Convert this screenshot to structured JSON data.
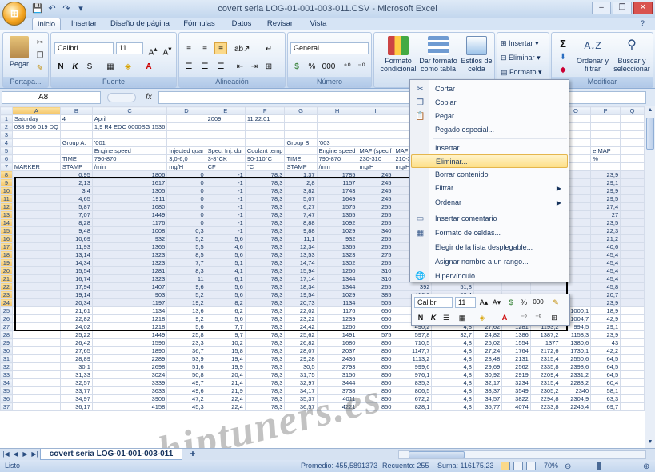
{
  "app": {
    "title": "covert seria LOG-01-001-003-011.CSV - Microsoft Excel"
  },
  "tabs": [
    "Inicio",
    "Insertar",
    "Diseño de página",
    "Fórmulas",
    "Datos",
    "Revisar",
    "Vista"
  ],
  "ribbon": {
    "portapapeles": {
      "label": "Portapa...",
      "paste": "Pegar"
    },
    "fuente": {
      "label": "Fuente",
      "font": "Calibri",
      "size": "11",
      "bold": "N",
      "italic": "K",
      "underline": "S"
    },
    "alineacion": {
      "label": "Alineación"
    },
    "numero": {
      "label": "Número",
      "format": "General",
      "percent": "%",
      "thousands": "000"
    },
    "estilos": {
      "cond": "Formato condicional",
      "table": "Dar formato como tabla",
      "cell": "Estilos de celda"
    },
    "celdas": {
      "insert": "Insertar",
      "delete": "Eliminar",
      "format": "Formato"
    },
    "modificar": {
      "label": "Modificar",
      "sort": "Ordenar y filtrar",
      "find": "Buscar y seleccionar",
      "sum": "Σ"
    }
  },
  "formula_bar": {
    "namebox": "A8",
    "fx": "fx",
    "value": ""
  },
  "grid": {
    "columns": [
      "A",
      "B",
      "C",
      "D",
      "E",
      "F",
      "G",
      "H",
      "I",
      "J",
      "K",
      "L",
      "M",
      "N",
      "O",
      "P",
      "Q"
    ],
    "rows": [
      {
        "n": "1",
        "c": [
          "Saturday",
          "4",
          "April",
          "",
          "2009",
          "11:22:01",
          "",
          "",
          "",
          "",
          "",
          "",
          "",
          "",
          "",
          "",
          ""
        ]
      },
      {
        "n": "2",
        "c": [
          "038 906 019 DQ",
          "",
          "1,9 R4 EDC 0000SG 1536",
          "",
          "",
          "",
          "",
          "",
          "",
          "",
          "",
          "",
          "",
          "",
          "",
          "",
          ""
        ]
      },
      {
        "n": "3",
        "c": [
          "",
          "",
          "",
          "",
          "",
          "",
          "",
          "",
          "",
          "",
          "",
          "",
          "",
          "",
          "",
          "",
          ""
        ]
      },
      {
        "n": "4",
        "c": [
          "",
          "Group A:",
          "'001",
          "",
          "",
          "",
          "Group B:",
          "'003",
          "",
          "",
          "",
          "",
          "",
          "",
          "",
          "",
          ""
        ]
      },
      {
        "n": "5",
        "c": [
          "",
          "",
          "Engine speed",
          "Injected quar",
          "Spec. Inj. dur",
          "Coolant temp",
          "",
          "Engine speed",
          "MAF (specif",
          "MAF (actual)",
          "EGR duty cycl",
          "",
          "",
          "",
          "",
          "e MAP",
          ""
        ]
      },
      {
        "n": "6",
        "c": [
          "",
          "TIME",
          "790-870",
          "3,0-6,0",
          "3-8°CK",
          "90-110°C",
          "TIME",
          "790-870",
          "230-310",
          "210-350",
          "40-75%",
          "",
          "",
          "",
          "",
          "%",
          ""
        ]
      },
      {
        "n": "7",
        "c": [
          "MARKER",
          "STAMP",
          "/min",
          "mg/H",
          "CF",
          "°C",
          "STAMP",
          "/min",
          "mg/H",
          "mg/H",
          "%",
          "",
          "",
          "",
          "",
          "",
          ""
        ]
      },
      {
        "n": "8",
        "c": [
          "",
          "0,95",
          "1806",
          "0",
          "-1",
          "78,3",
          "1,37",
          "1785",
          "245",
          "254,8",
          "72,1",
          "",
          "",
          "",
          "",
          "23,9",
          ""
        ]
      },
      {
        "n": "9",
        "c": [
          "",
          "2,13",
          "1617",
          "0",
          "-1",
          "78,3",
          "2,8",
          "1157",
          "245",
          "259,7",
          "72,1",
          "",
          "",
          "",
          "",
          "29,1",
          ""
        ]
      },
      {
        "n": "10",
        "c": [
          "",
          "3,4",
          "1305",
          "0",
          "-1",
          "78,3",
          "3,82",
          "1743",
          "245",
          "210,7",
          "62,2",
          "",
          "",
          "",
          "",
          "29,9",
          ""
        ]
      },
      {
        "n": "11",
        "c": [
          "",
          "4,65",
          "1911",
          "0",
          "-1",
          "78,3",
          "5,07",
          "1649",
          "245",
          "245",
          "64,5",
          "",
          "",
          "",
          "",
          "29,5",
          ""
        ]
      },
      {
        "n": "12",
        "c": [
          "",
          "5,87",
          "1680",
          "0",
          "-1",
          "78,3",
          "6,27",
          "1575",
          "255",
          "249,9",
          "64,5",
          "",
          "",
          "",
          "",
          "27,4",
          ""
        ]
      },
      {
        "n": "13",
        "c": [
          "",
          "7,07",
          "1449",
          "0",
          "-1",
          "78,3",
          "7,47",
          "1365",
          "265",
          "254,8",
          "63",
          "",
          "",
          "",
          "",
          "27",
          ""
        ]
      },
      {
        "n": "14",
        "c": [
          "",
          "8,28",
          "1176",
          "0",
          "-1",
          "78,3",
          "8,88",
          "1092",
          "265",
          "264,6",
          "64,9",
          "",
          "",
          "",
          "",
          "23,5",
          ""
        ]
      },
      {
        "n": "15",
        "c": [
          "",
          "9,48",
          "1008",
          "0,3",
          "-1",
          "78,3",
          "9,88",
          "1029",
          "340",
          "225,2",
          "88,1",
          "",
          "",
          "",
          "",
          "22,3",
          ""
        ]
      },
      {
        "n": "16",
        "c": [
          "",
          "10,69",
          "932",
          "5,2",
          "5,6",
          "78,3",
          "11,1",
          "932",
          "265",
          "299,6",
          "88,1",
          "",
          "",
          "",
          "",
          "21,2",
          ""
        ]
      },
      {
        "n": "17",
        "c": [
          "",
          "11,93",
          "1365",
          "5,5",
          "4,6",
          "78,3",
          "12,34",
          "1365",
          "265",
          "254,8",
          "69,7",
          "",
          "",
          "",
          "",
          "40,6",
          ""
        ]
      },
      {
        "n": "18",
        "c": [
          "",
          "13,14",
          "1323",
          "8,5",
          "5,6",
          "78,3",
          "13,53",
          "1323",
          "275",
          "245",
          "69,3",
          "",
          "",
          "",
          "",
          "45,4",
          ""
        ]
      },
      {
        "n": "19",
        "c": [
          "",
          "14,34",
          "1323",
          "7,7",
          "5,1",
          "78,3",
          "14,74",
          "1302",
          "265",
          "274,4",
          "64,1",
          "",
          "",
          "",
          "",
          "45,4",
          ""
        ]
      },
      {
        "n": "20",
        "c": [
          "",
          "15,54",
          "1281",
          "8,3",
          "4,1",
          "78,3",
          "15,94",
          "1260",
          "310",
          "230,3",
          "65,7",
          "",
          "",
          "",
          "",
          "45,4",
          ""
        ]
      },
      {
        "n": "21",
        "c": [
          "",
          "16,74",
          "1323",
          "11",
          "6,1",
          "78,3",
          "17,14",
          "1344",
          "310",
          "289,2",
          "66,2",
          "",
          "",
          "",
          "",
          "45,4",
          ""
        ]
      },
      {
        "n": "22",
        "c": [
          "",
          "17,94",
          "1407",
          "9,6",
          "5,6",
          "78,3",
          "18,34",
          "1344",
          "265",
          "392",
          "51,8",
          "",
          "",
          "",
          "",
          "45,8",
          ""
        ]
      },
      {
        "n": "23",
        "c": [
          "",
          "19,14",
          "903",
          "5,2",
          "5,6",
          "78,3",
          "19,54",
          "1029",
          "385",
          "416,8",
          "58,4",
          "",
          "",
          "",
          "",
          "20,7",
          ""
        ]
      },
      {
        "n": "24",
        "c": [
          "",
          "20,34",
          "1197",
          "19,2",
          "8,2",
          "78,3",
          "20,73",
          "1134",
          "505",
          "480,2",
          "30,8",
          "",
          "",
          "",
          "",
          "23,9",
          ""
        ]
      },
      {
        "n": "25",
        "c": [
          "",
          "21,61",
          "1134",
          "13,6",
          "6,2",
          "78,3",
          "22,02",
          "1176",
          "650",
          "592,8",
          "63,8",
          "22,19",
          "1071",
          "1244,4",
          "1000,1",
          "18,9",
          ""
        ]
      },
      {
        "n": "26",
        "c": [
          "",
          "22,82",
          "1218",
          "9,2",
          "5,6",
          "78,3",
          "23,22",
          "1239",
          "650",
          "269,9",
          "60,1",
          "22,42",
          "1018",
          "1091,4",
          "1004,7",
          "42,9",
          ""
        ]
      },
      {
        "n": "27",
        "c": [
          "",
          "24,02",
          "1218",
          "5,6",
          "7,7",
          "78,3",
          "24,42",
          "1260",
          "650",
          "490,2",
          "4,8",
          "27,62",
          "1281",
          "1193,2",
          "994,5",
          "29,1",
          ""
        ]
      },
      {
        "n": "28",
        "c": [
          "",
          "25,22",
          "1449",
          "25,8",
          "9,7",
          "78,3",
          "25,62",
          "1491",
          "575",
          "597,8",
          "32,7",
          "24,82",
          "1386",
          "1387,2",
          "1158,3",
          "23,9",
          ""
        ]
      },
      {
        "n": "29",
        "c": [
          "",
          "26,42",
          "1596",
          "23,3",
          "10,2",
          "78,3",
          "26,82",
          "1680",
          "850",
          "710,5",
          "4,8",
          "26,02",
          "1554",
          "1377",
          "1380,6",
          "43",
          ""
        ]
      },
      {
        "n": "30",
        "c": [
          "",
          "27,65",
          "1890",
          "36,7",
          "15,8",
          "78,3",
          "28,07",
          "2037",
          "850",
          "1147,7",
          "4,8",
          "27,24",
          "1764",
          "2172,6",
          "1730,1",
          "42,2",
          ""
        ]
      },
      {
        "n": "31",
        "c": [
          "",
          "28,89",
          "2289",
          "53,9",
          "19,4",
          "78,3",
          "29,28",
          "2436",
          "850",
          "1113,2",
          "4,8",
          "28,48",
          "2131",
          "2315,4",
          "2550,6",
          "64,5",
          ""
        ]
      },
      {
        "n": "32",
        "c": [
          "",
          "30,1",
          "2698",
          "51,6",
          "19,9",
          "78,3",
          "30,5",
          "2793",
          "850",
          "999,6",
          "4,8",
          "29,69",
          "2562",
          "2335,8",
          "2398,6",
          "64,5",
          ""
        ]
      },
      {
        "n": "33",
        "c": [
          "",
          "31,33",
          "3024",
          "50,8",
          "20,4",
          "78,3",
          "31,75",
          "3150",
          "850",
          "976,1",
          "4,8",
          "30,92",
          "2919",
          "2209,4",
          "2331,2",
          "64,5",
          ""
        ]
      },
      {
        "n": "34",
        "c": [
          "",
          "32,57",
          "3339",
          "49,7",
          "21,4",
          "78,3",
          "32,97",
          "3444",
          "850",
          "835,3",
          "4,8",
          "32,17",
          "3234",
          "2315,4",
          "2283,2",
          "60,4",
          ""
        ]
      },
      {
        "n": "35",
        "c": [
          "",
          "33,77",
          "3633",
          "49,6",
          "21,9",
          "78,3",
          "34,17",
          "3738",
          "850",
          "806,5",
          "4,8",
          "33,37",
          "3549",
          "2305,2",
          "2340",
          "58,1",
          ""
        ]
      },
      {
        "n": "36",
        "c": [
          "",
          "34,97",
          "3906",
          "47,2",
          "22,4",
          "78,3",
          "35,37",
          "4011",
          "850",
          "672,2",
          "4,8",
          "34,57",
          "3822",
          "2294,8",
          "2304,9",
          "63,3",
          ""
        ]
      },
      {
        "n": "37",
        "c": [
          "",
          "36,17",
          "4158",
          "45,3",
          "22,4",
          "78,3",
          "36,57",
          "4221",
          "850",
          "828,1",
          "4,8",
          "35,77",
          "4074",
          "2233,8",
          "2245,4",
          "69,7",
          ""
        ]
      }
    ]
  },
  "context_menu": {
    "items": [
      {
        "label": "Cortar",
        "icon": "scissors-icon",
        "glyph": "✂"
      },
      {
        "label": "Copiar",
        "icon": "copy-icon",
        "glyph": "❐"
      },
      {
        "label": "Pegar",
        "icon": "paste-icon",
        "glyph": "📋"
      },
      {
        "label": "Pegado especial...",
        "icon": "",
        "glyph": ""
      },
      {
        "label": "Insertar...",
        "icon": "",
        "glyph": ""
      },
      {
        "label": "Eliminar...",
        "icon": "",
        "glyph": ""
      },
      {
        "label": "Borrar contenido",
        "icon": "",
        "glyph": ""
      },
      {
        "label": "Filtrar",
        "icon": "",
        "glyph": ""
      },
      {
        "label": "Ordenar",
        "icon": "",
        "glyph": ""
      },
      {
        "label": "Insertar comentario",
        "icon": "comment-icon",
        "glyph": "▭"
      },
      {
        "label": "Formato de celdas...",
        "icon": "format-cells-icon",
        "glyph": "▦"
      },
      {
        "label": "Elegir de la lista desplegable...",
        "icon": "",
        "glyph": ""
      },
      {
        "label": "Asignar nombre a un rango...",
        "icon": "",
        "glyph": ""
      },
      {
        "label": "Hipervínculo...",
        "icon": "hyperlink-icon",
        "glyph": "🌐"
      }
    ]
  },
  "mini_toolbar": {
    "font": "Calibri",
    "size": "11",
    "percent": "%",
    "thousands": "000"
  },
  "sheet": {
    "tab": "covert seria LOG-01-001-003-011"
  },
  "status": {
    "ready": "Listo",
    "average": "Promedio: 455,5891373",
    "count": "Recuento: 255",
    "sum": "Suma: 116175,23",
    "zoom": "70%"
  },
  "watermark": "chiptuners.es"
}
